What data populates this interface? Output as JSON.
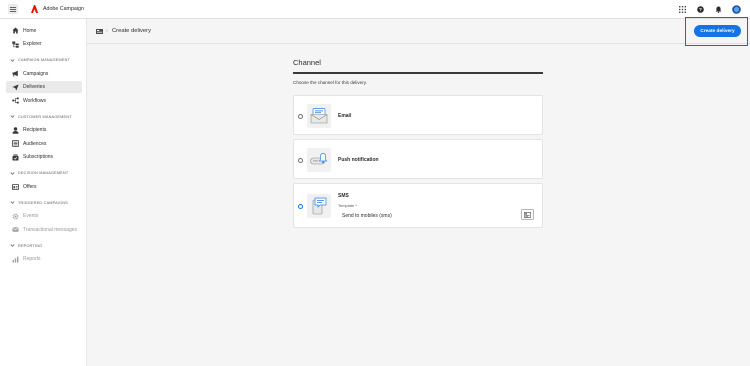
{
  "app": {
    "title": "Adobe Campaign"
  },
  "sidebar": {
    "top_items": [
      {
        "label": "Home"
      },
      {
        "label": "Explorer"
      }
    ],
    "sections": [
      {
        "title": "CAMPAIGN MANAGEMENT",
        "items": [
          {
            "label": "Campaigns"
          },
          {
            "label": "Deliveries"
          },
          {
            "label": "Workflows"
          }
        ]
      },
      {
        "title": "CUSTOMER MANAGEMENT",
        "items": [
          {
            "label": "Recipients"
          },
          {
            "label": "Audiences"
          },
          {
            "label": "Subscriptions"
          }
        ]
      },
      {
        "title": "DECISION MANAGEMENT",
        "items": [
          {
            "label": "Offers"
          }
        ]
      },
      {
        "title": "TRIGGERED CAMPAIGNS",
        "items": [
          {
            "label": "Events"
          },
          {
            "label": "Transactional messages"
          }
        ]
      },
      {
        "title": "REPORTING",
        "items": [
          {
            "label": "Reports"
          }
        ]
      }
    ],
    "active_item": "Deliveries"
  },
  "header": {
    "breadcrumb_sep": "›",
    "title": "Create delivery",
    "primary_button": "Create delivery"
  },
  "channel": {
    "heading": "Channel",
    "subtitle": "Choose the channel for this delivery.",
    "options": [
      {
        "label": "Email",
        "checked": false
      },
      {
        "label": "Push notification",
        "checked": false
      },
      {
        "label": "SMS",
        "checked": true,
        "template_label": "Template",
        "template_required": "*",
        "template_value": "Send to mobiles (sms)"
      }
    ]
  },
  "colors": {
    "accent": "#1473e6",
    "highlight": "#d7262a",
    "sidebar_active": "#eaeaea"
  }
}
